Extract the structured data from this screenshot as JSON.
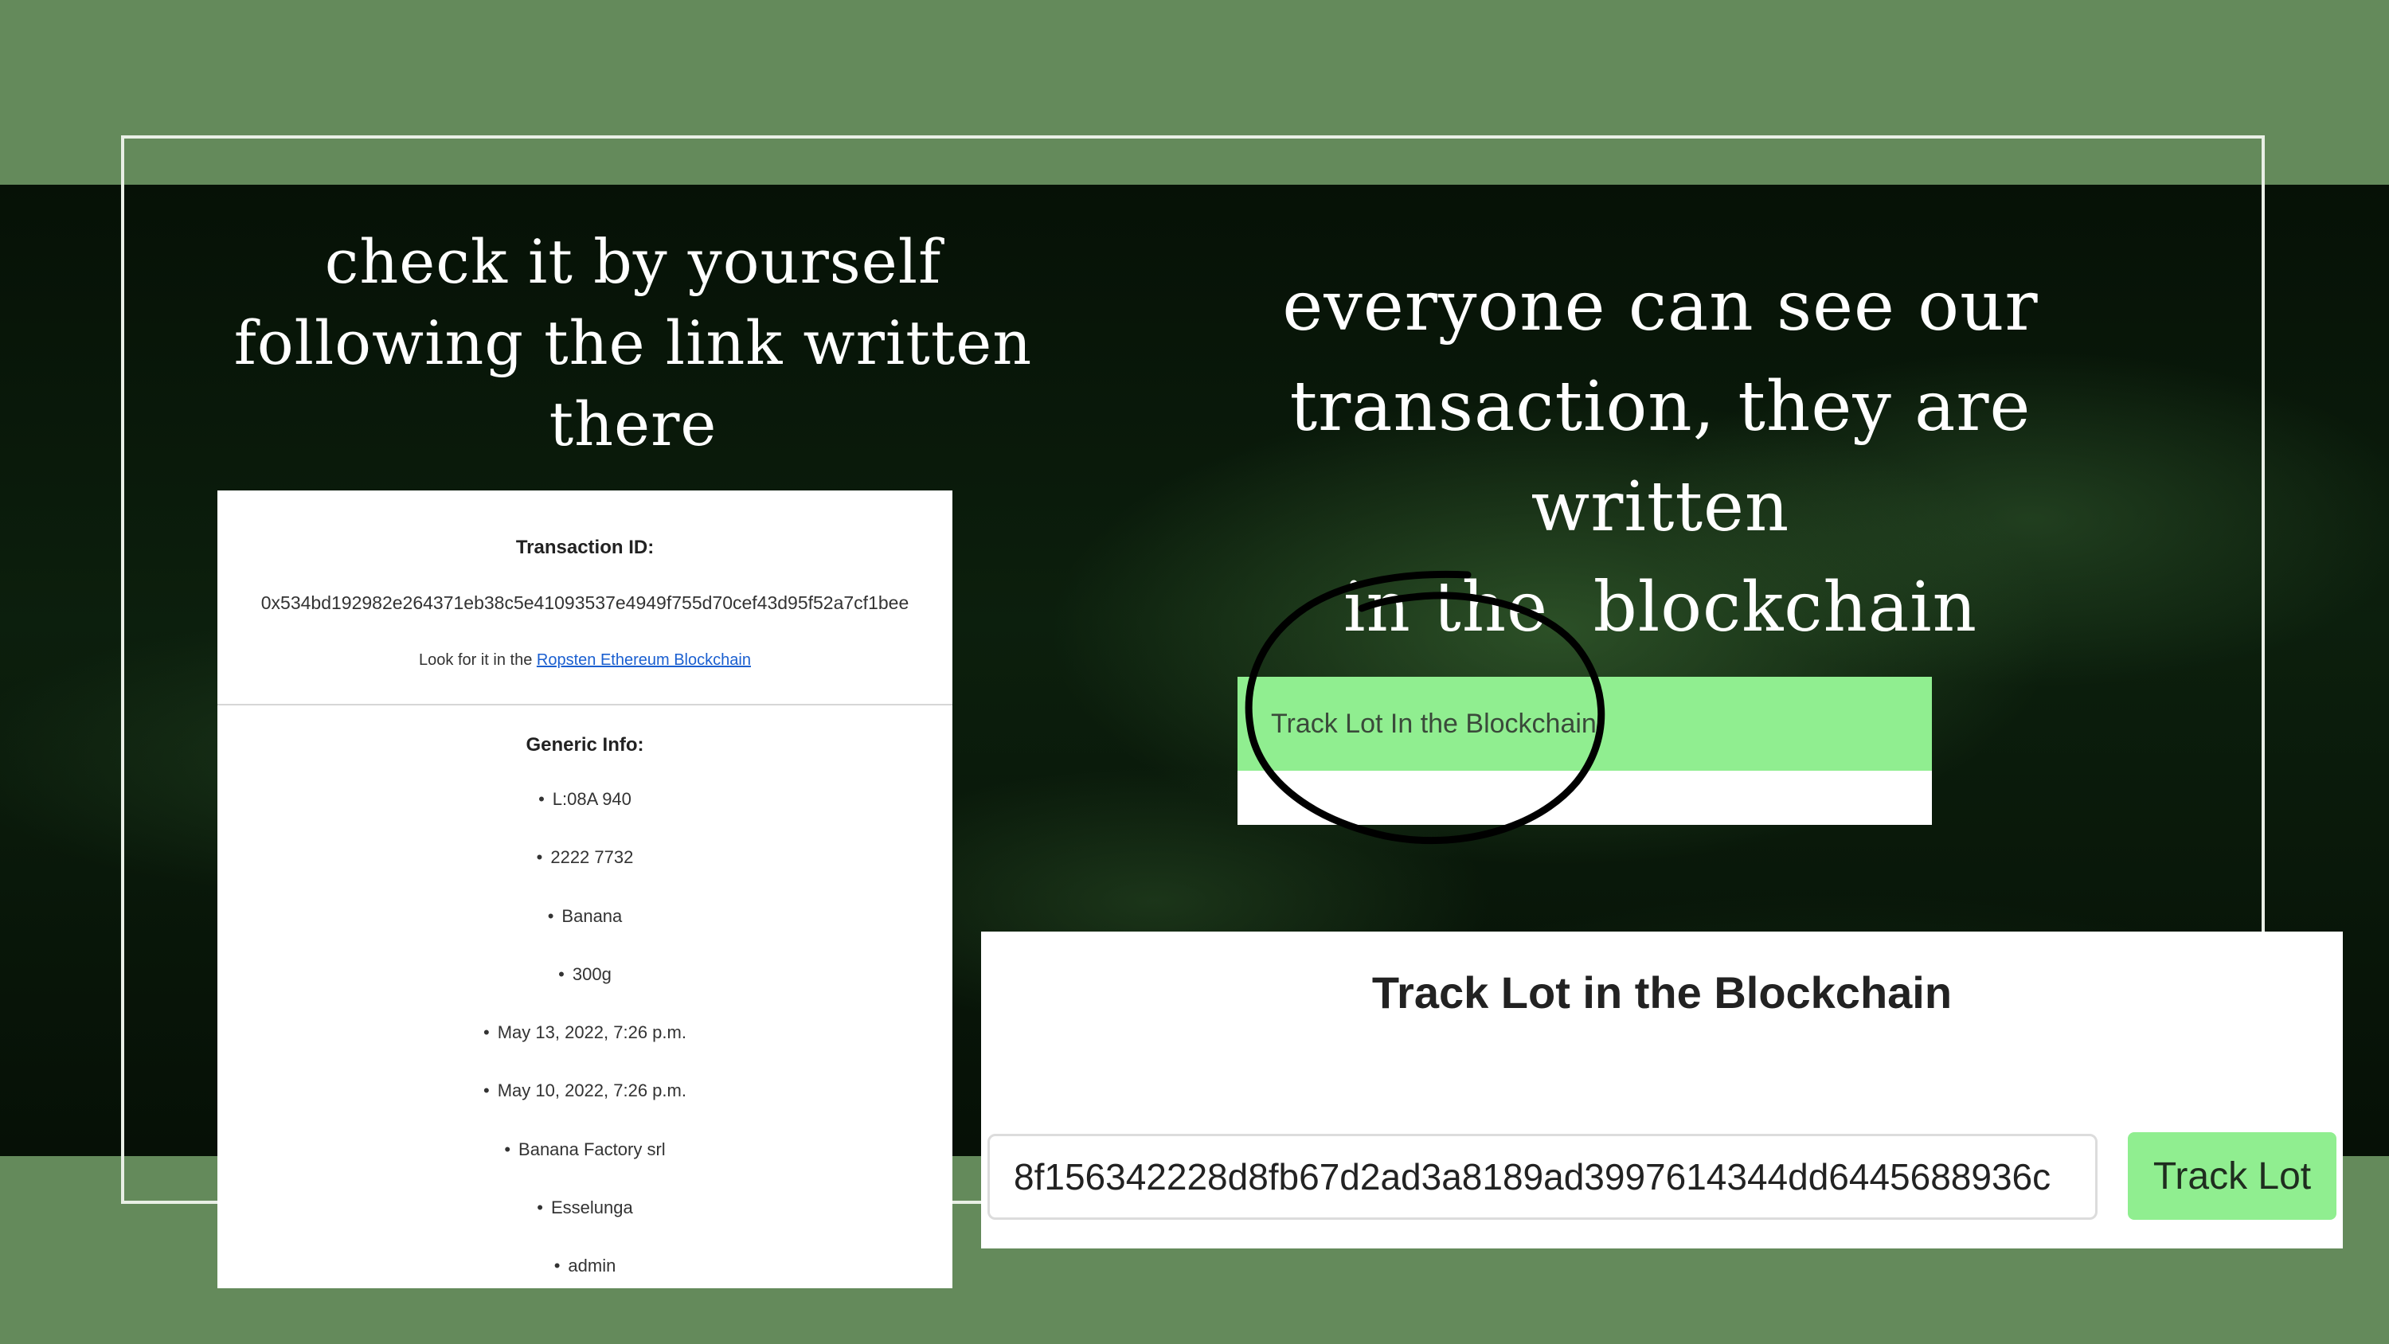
{
  "left_headline": {
    "line1": "check it by yourself",
    "line2": "following the link written",
    "line3": "there"
  },
  "right_headline": {
    "line1": "everyone can see our",
    "line2": "transaction, they are written",
    "line3": "in the  blockchain"
  },
  "transaction_card": {
    "title": "Transaction ID:",
    "id": "0x534bd192982e264371eb38c5e41093537e4949f755d70cef43d95f52a7cf1bee",
    "look_prefix": "Look for it in the ",
    "look_link": "Ropsten Ethereum Blockchain",
    "generic_title": "Generic Info:",
    "items": [
      "L:08A 940",
      "2222 7732",
      "Banana",
      "300g",
      "May 13, 2022, 7:26 p.m.",
      "May 10, 2022, 7:26 p.m.",
      "Banana Factory srl",
      "Esselunga",
      "admin"
    ]
  },
  "track_button": {
    "label": "Track Lot In the Blockchain"
  },
  "track_panel": {
    "title": "Track Lot in the Blockchain",
    "input_value": "8f156342228d8fb67d2ad3a8189ad3997614344dd6445688936c",
    "button_label": "Track Lot"
  },
  "colors": {
    "background_green": "#648a5b",
    "button_green": "#90ee90",
    "link_blue": "#1a5fd0"
  }
}
